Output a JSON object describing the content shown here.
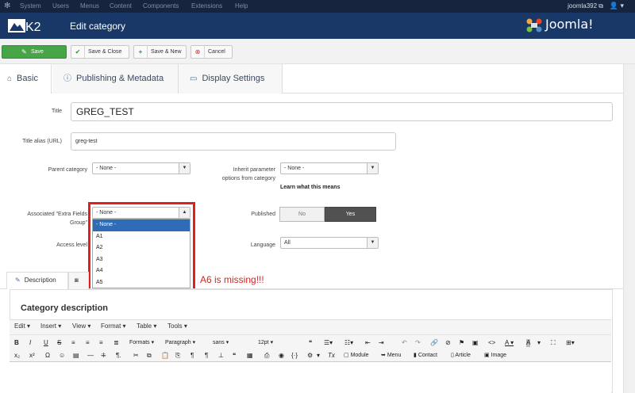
{
  "topmenu": {
    "items": [
      "System",
      "Users",
      "Menus",
      "Content",
      "Components",
      "Extensions",
      "Help"
    ],
    "site_name": "joomla392 ⧉",
    "user_icon": "👤 ▾"
  },
  "header": {
    "k2_logo": "K2",
    "page_title": "Edit category",
    "joomla_logo": "Joomla!"
  },
  "toolbar": {
    "save_label": "Save",
    "save_close_label": "Save & Close",
    "save_new_label": "Save & New",
    "cancel_label": "Cancel"
  },
  "tabs": {
    "basic": "Basic",
    "publishing": "Publishing & Metadata",
    "display": "Display Settings"
  },
  "form": {
    "title_label": "Title",
    "title_value": "GREG_TEST",
    "alias_label": "Title alias (URL)",
    "alias_value": "greg-test",
    "parent_label": "Parent category",
    "parent_value": "- None -",
    "inherit_label_1": "Inherit parameter",
    "inherit_label_2": "options from category",
    "inherit_value": "- None -",
    "learn_more": "Learn what this means",
    "extra_label_1": "Associated \"Extra Fields",
    "extra_label_2": "Group\"",
    "extra_value": "- None -",
    "extra_options": [
      "- None -",
      "A1",
      "A2",
      "A3",
      "A4",
      "A5"
    ],
    "published_label": "Published",
    "published_no": "No",
    "published_yes": "Yes",
    "access_label": "Access level",
    "language_label": "Language",
    "language_value": "All"
  },
  "annotation": "A6 is missing!!!",
  "lower_tabs": {
    "description": "Description"
  },
  "editor": {
    "section_title": "Category description",
    "menus": [
      "Edit ▾",
      "Insert ▾",
      "View ▾",
      "Format ▾",
      "Table ▾",
      "Tools ▾"
    ],
    "formats": "Formats ▾",
    "paragraph": "Paragraph ▾",
    "font": "sans ▾",
    "size": "12pt ▾",
    "module_btn": "Module",
    "menu_btn": "Menu",
    "contact_btn": "Contact",
    "article_btn": "Article",
    "image_btn": "Image"
  },
  "colors": {
    "topbar": "#16243d",
    "header": "#1a3867",
    "save_green": "#46a546",
    "selected_blue": "#2f6cb7",
    "annotation_red": "#e0201c"
  }
}
